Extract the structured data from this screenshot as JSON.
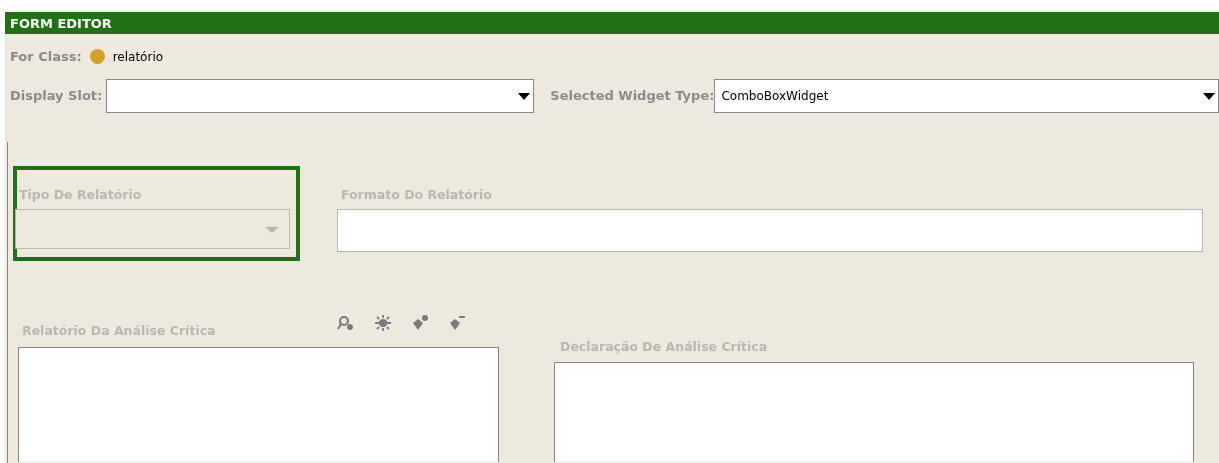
{
  "panel": {
    "title": "FORM EDITOR"
  },
  "for_class": {
    "label": "For Class:",
    "value": "relatório",
    "color": "#d4a02a"
  },
  "display_slot": {
    "label": "Display Slot:"
  },
  "widget_type": {
    "label": "Selected Widget Type:",
    "value": "ComboBoxWidget"
  },
  "widgets": [
    {
      "kind": "combo",
      "label": "Tipo De Relatório",
      "selected": true
    },
    {
      "kind": "text",
      "label": "Formato Do Relatório",
      "selected": false
    },
    {
      "kind": "list",
      "label": "Relatório Da Análise Crítica",
      "selected": false
    },
    {
      "kind": "textarea",
      "label": "Declaração De Análise Crítica",
      "selected": false
    }
  ]
}
